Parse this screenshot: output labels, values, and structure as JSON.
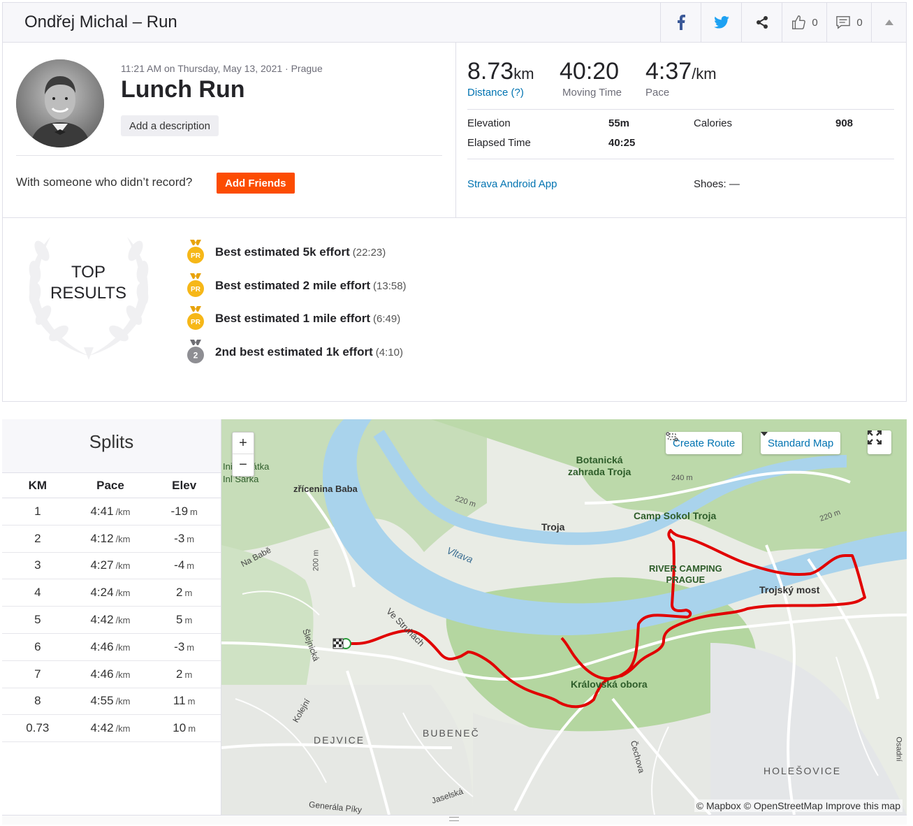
{
  "header": {
    "title": "Ondřej Michal – Run",
    "kudos_count": "0",
    "comment_count": "0"
  },
  "activity": {
    "meta": "11:21 AM on Thursday, May 13, 2021 · Prague",
    "name": "Lunch Run",
    "add_description": "Add a description",
    "friends_prompt": "With someone who didn’t record?",
    "add_friends": "Add Friends"
  },
  "stats": {
    "distance": {
      "value": "8.73",
      "unit": "km",
      "label": "Distance (?)"
    },
    "moving_time": {
      "value": "40:20",
      "label": "Moving Time"
    },
    "pace": {
      "value": "4:37",
      "unit": "/km",
      "label": "Pace"
    },
    "elevation_label": "Elevation",
    "elevation_value": "55m",
    "calories_label": "Calories",
    "calories_value": "908",
    "elapsed_label": "Elapsed Time",
    "elapsed_value": "40:25",
    "device": "Strava Android App",
    "shoes": "Shoes: —"
  },
  "top_results": {
    "title_line1": "TOP",
    "title_line2": "RESULTS",
    "items": [
      {
        "text": "Best estimated 5k effort",
        "time": "(22:23)",
        "medal": "PR",
        "medal_color": "#f6b718"
      },
      {
        "text": "Best estimated 2 mile effort",
        "time": "(13:58)",
        "medal": "PR",
        "medal_color": "#f6b718"
      },
      {
        "text": "Best estimated 1 mile effort",
        "time": "(6:49)",
        "medal": "PR",
        "medal_color": "#f6b718"
      },
      {
        "text": "2nd best estimated 1k effort",
        "time": "(4:10)",
        "medal": "2",
        "medal_color": "#8e8e93"
      }
    ]
  },
  "splits": {
    "title": "Splits",
    "columns": [
      "KM",
      "Pace",
      "Elev"
    ],
    "pace_unit": "/km",
    "elev_unit": "m",
    "rows": [
      {
        "km": "1",
        "pace": "4:41",
        "elev": "-19"
      },
      {
        "km": "2",
        "pace": "4:12",
        "elev": "-3"
      },
      {
        "km": "3",
        "pace": "4:27",
        "elev": "-4"
      },
      {
        "km": "4",
        "pace": "4:24",
        "elev": "2"
      },
      {
        "km": "5",
        "pace": "4:42",
        "elev": "5"
      },
      {
        "km": "6",
        "pace": "4:46",
        "elev": "-3"
      },
      {
        "km": "7",
        "pace": "4:46",
        "elev": "2"
      },
      {
        "km": "8",
        "pace": "4:55",
        "elev": "11"
      },
      {
        "km": "0.73",
        "pace": "4:42",
        "elev": "10"
      }
    ]
  },
  "map": {
    "zoom_in": "+",
    "zoom_out": "−",
    "create_route": "Create Route",
    "map_style": "Standard Map",
    "attribution": "© Mapbox © OpenStreetMap Improve this map",
    "labels": {
      "botanicka": "Botanická",
      "botanicka2": "zahrada Troja",
      "troja": "Troja",
      "camp": "Camp Sokol Troja",
      "river_camping": "RIVER CAMPING",
      "prague": "PRAGUE",
      "trojsky": "Trojský most",
      "kralovska": "Královská obora",
      "vltava": "Vltava",
      "baba": "zřícenina Baba",
      "nababe": "Na Babě",
      "strudlu": "Ve Struhách",
      "slejnicka": "Šlejnická",
      "kolejni": "Kolejní",
      "dejvice": "DEJVICE",
      "bubenec": "BUBENEČ",
      "holesovice": "HOLEŠOVICE",
      "cechova": "Čechova",
      "jaselska": "Jaselská",
      "generala": "Generála Píky",
      "osadni": "Osadní",
      "sarka1": "Ini",
      "sarka1b": "átka",
      "sarka2": "Inl Šárka",
      "e220a": "220 m",
      "e220b": "220 m",
      "e240": "240 m",
      "e200": "200 m"
    }
  }
}
